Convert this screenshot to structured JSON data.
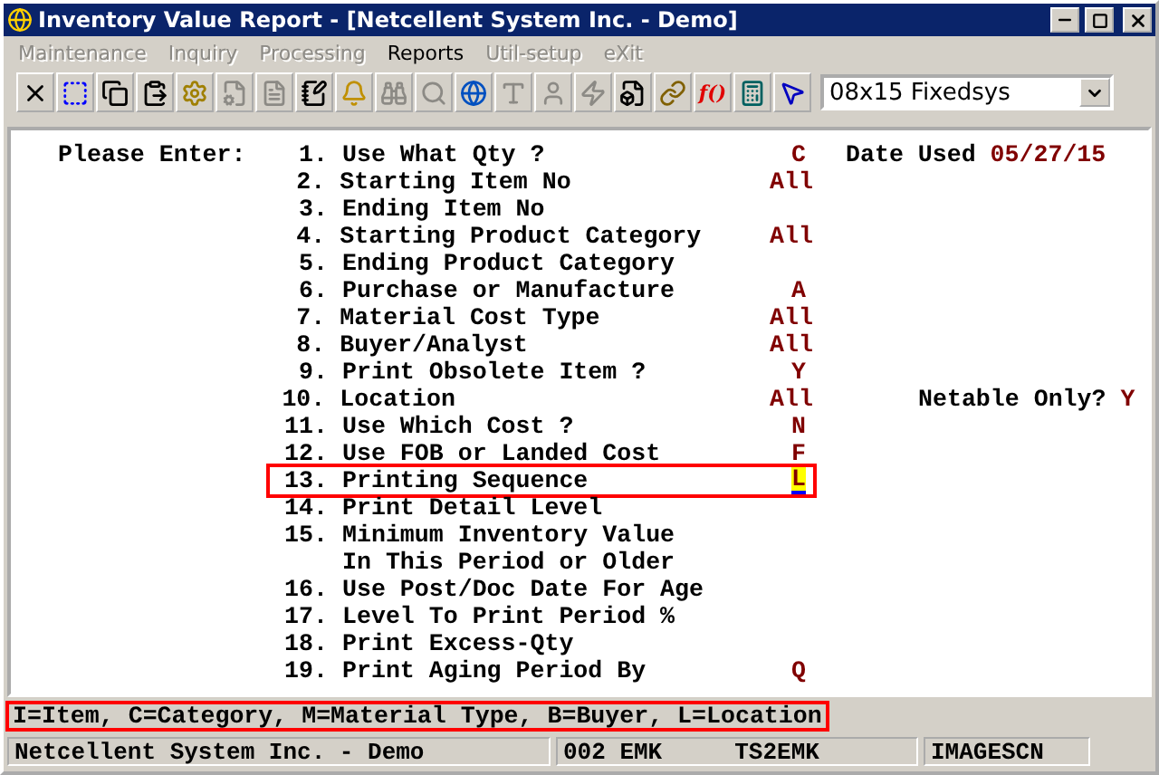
{
  "window": {
    "title": "Inventory Value Report - [Netcellent System Inc. - Demo]"
  },
  "menu": [
    {
      "label": "Maintenance",
      "disabled": true
    },
    {
      "label": "Inquiry",
      "disabled": true
    },
    {
      "label": "Processing",
      "disabled": true
    },
    {
      "label": "Reports",
      "disabled": false
    },
    {
      "label": "Util-setup",
      "disabled": true
    },
    {
      "label": "eXit",
      "disabled": true
    }
  ],
  "toolbar": [
    {
      "kind": "close",
      "disabled": false
    },
    {
      "kind": "select",
      "disabled": false
    },
    {
      "kind": "copy",
      "disabled": false
    },
    {
      "kind": "paste",
      "disabled": false
    },
    {
      "kind": "gear",
      "disabled": false
    },
    {
      "kind": "docgear",
      "disabled": true
    },
    {
      "kind": "doc",
      "disabled": true
    },
    {
      "kind": "note",
      "disabled": false
    },
    {
      "kind": "bell",
      "disabled": false
    },
    {
      "kind": "binoculars",
      "disabled": true
    },
    {
      "kind": "search",
      "disabled": true
    },
    {
      "kind": "globe",
      "disabled": false
    },
    {
      "kind": "font",
      "disabled": true
    },
    {
      "kind": "user",
      "disabled": true
    },
    {
      "kind": "bolt",
      "disabled": true
    },
    {
      "kind": "boltdoc",
      "disabled": false
    },
    {
      "kind": "link",
      "disabled": false
    },
    {
      "kind": "function",
      "disabled": false,
      "label": "f()"
    },
    {
      "kind": "calculator",
      "disabled": false
    },
    {
      "kind": "help",
      "disabled": false
    }
  ],
  "font_select": {
    "value": "08x15 Fixedsys"
  },
  "form": {
    "prompt": "Please Enter:",
    "rows": [
      {
        "number": "1.",
        "label": "Use What Qty ?",
        "value": "C",
        "extra_label": "Date Used",
        "extra_value": "05/27/15",
        "selected": false
      },
      {
        "number": "2.",
        "label": "Starting Item No",
        "value": "All",
        "selected": false
      },
      {
        "number": "3.",
        "label": "Ending Item No",
        "selected": false
      },
      {
        "number": "4.",
        "label": "Starting Product Category",
        "value": "All",
        "selected": false
      },
      {
        "number": "5.",
        "label": "Ending Product Category",
        "selected": false
      },
      {
        "number": "6.",
        "label": "Purchase or Manufacture",
        "value": "A",
        "selected": false
      },
      {
        "number": "7.",
        "label": "Material Cost Type",
        "value": "All",
        "selected": false
      },
      {
        "number": "8.",
        "label": "Buyer/Analyst",
        "value": "All",
        "selected": false
      },
      {
        "number": "9.",
        "label": "Print Obsolete Item ?",
        "value": "Y",
        "selected": false
      },
      {
        "number": "10.",
        "label": "Location",
        "value": "All",
        "extra_label": "Netable Only?",
        "extra_value": "Y",
        "selected": false
      },
      {
        "number": "11.",
        "label": "Use Which Cost ?",
        "value": "N",
        "selected": false
      },
      {
        "number": "12.",
        "label": "Use FOB or Landed Cost",
        "value": "F",
        "selected": false
      },
      {
        "number": "13.",
        "label": "Printing Sequence",
        "value": "L",
        "selected": true
      },
      {
        "number": "14.",
        "label": "Print Detail Level",
        "selected": false
      },
      {
        "number": "15.",
        "label": "Minimum Inventory Value",
        "selected": false
      },
      {
        "label": "In This Period or Older",
        "selected": false
      },
      {
        "number": "16.",
        "label": "Use Post/Doc Date For Age",
        "selected": false
      },
      {
        "number": "17.",
        "label": "Level To Print Period %",
        "selected": false
      },
      {
        "number": "18.",
        "label": "Print Excess-Qty",
        "selected": false
      },
      {
        "number": "19.",
        "label": "Print Aging Period By",
        "value": "Q",
        "selected": false
      }
    ]
  },
  "help_line": "I=Item, C=Category, M=Material Type, B=Buyer, L=Location",
  "status_bar": {
    "company": "Netcellent System Inc. - Demo",
    "user": "002 EMK",
    "terminal": "TS2EMK",
    "module": "IMAGESCN"
  }
}
